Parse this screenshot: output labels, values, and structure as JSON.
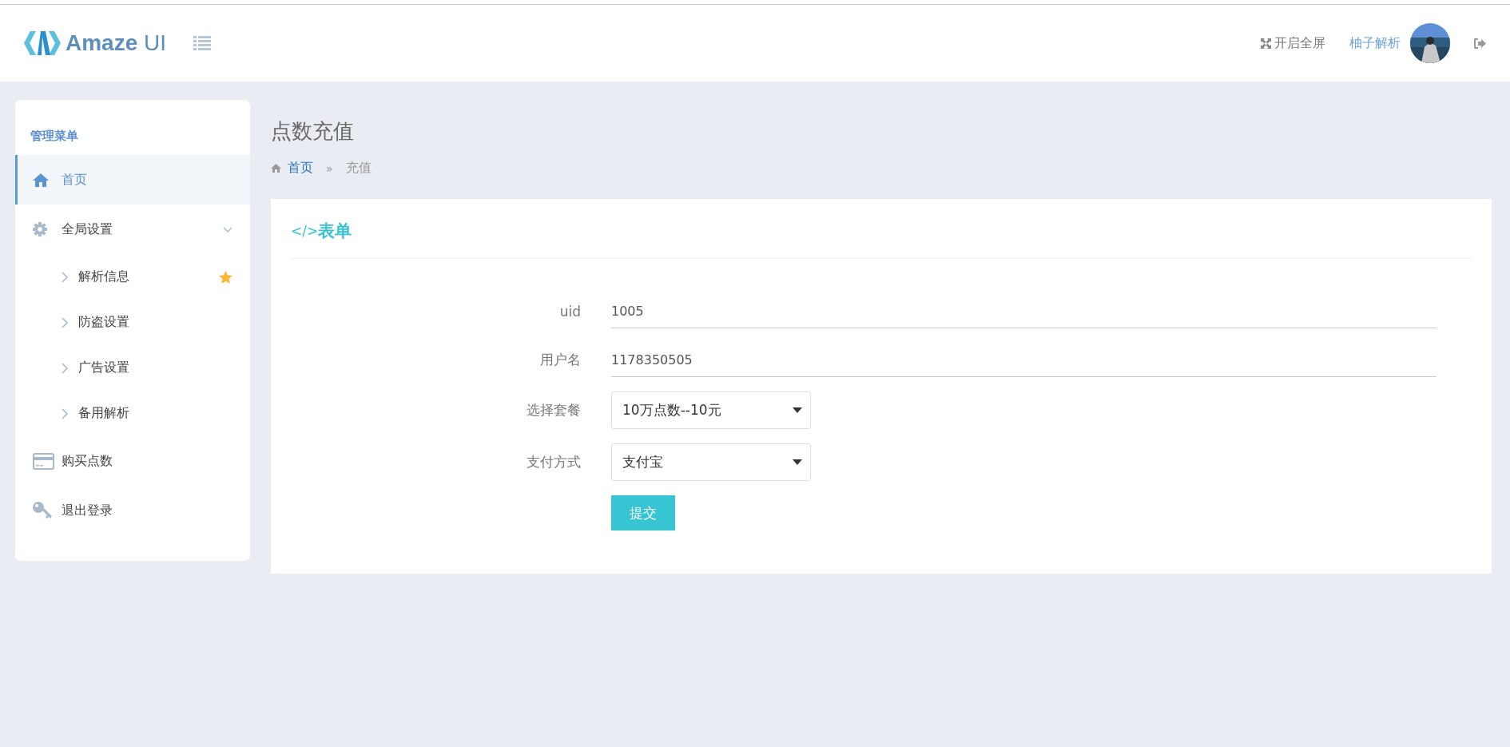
{
  "header": {
    "logo": {
      "name": "Amaze",
      "suffix": "UI"
    },
    "fullscreen": "开启全屏",
    "user": "柚子解析"
  },
  "sidebar": {
    "title": "管理菜单",
    "items": [
      {
        "kind": "home",
        "label": "首页",
        "selected": true
      },
      {
        "kind": "gear",
        "label": "全局设置",
        "selected": false,
        "expanded": true,
        "children": [
          {
            "label": "解析信息",
            "selected": false,
            "starred": true
          },
          {
            "label": "防盗设置",
            "selected": false,
            "starred": false
          },
          {
            "label": "广告设置",
            "selected": false,
            "starred": false
          },
          {
            "label": "备用解析",
            "selected": false,
            "starred": false
          }
        ]
      },
      {
        "kind": "card",
        "label": "购买点数",
        "selected": false
      },
      {
        "kind": "key",
        "label": "退出登录",
        "selected": false
      }
    ]
  },
  "page": {
    "title": "点数充值",
    "breadcrumb": [
      {
        "label": "首页",
        "kind": "link"
      },
      {
        "label": "»",
        "kind": "separator"
      },
      {
        "label": "充值",
        "kind": "current"
      }
    ]
  },
  "form": {
    "icon_text": "</>",
    "title": "表单",
    "fields": [
      {
        "kind": "text",
        "label": "uid",
        "value": "1005"
      },
      {
        "kind": "text",
        "label": "用户名",
        "value": "1178350505"
      },
      {
        "kind": "select",
        "label": "选择套餐",
        "value": "10万点数--10元"
      },
      {
        "kind": "select",
        "label": "支付方式",
        "value": "支付宝"
      }
    ],
    "submit": "提交"
  }
}
